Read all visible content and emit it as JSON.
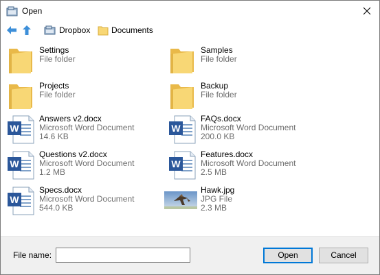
{
  "window": {
    "title": "Open"
  },
  "breadcrumb": {
    "items": [
      "Dropbox",
      "Documents"
    ]
  },
  "items": [
    {
      "name": "Settings",
      "type": "File folder",
      "size": "",
      "icon": "folder-icon"
    },
    {
      "name": "Samples",
      "type": "File folder",
      "size": "",
      "icon": "folder-icon"
    },
    {
      "name": "Projects",
      "type": "File folder",
      "size": "",
      "icon": "folder-icon"
    },
    {
      "name": "Backup",
      "type": "File folder",
      "size": "",
      "icon": "folder-icon"
    },
    {
      "name": "Answers v2.docx",
      "type": "Microsoft Word Document",
      "size": "14.6 KB",
      "icon": "word-document-icon"
    },
    {
      "name": "FAQs.docx",
      "type": "Microsoft Word Document",
      "size": "200.0 KB",
      "icon": "word-document-icon"
    },
    {
      "name": "Questions v2.docx",
      "type": "Microsoft Word Document",
      "size": "1.2 MB",
      "icon": "word-document-icon"
    },
    {
      "name": "Features.docx",
      "type": "Microsoft Word Document",
      "size": "2.5 MB",
      "icon": "word-document-icon"
    },
    {
      "name": "Specs.docx",
      "type": "Microsoft Word Document",
      "size": "544.0 KB",
      "icon": "word-document-icon"
    },
    {
      "name": "Hawk.jpg",
      "type": "JPG File",
      "size": "2.3 MB",
      "icon": "image-thumbnail-icon"
    }
  ],
  "footer": {
    "file_name_label": "File name:",
    "file_name_value": "",
    "open_label": "Open",
    "cancel_label": "Cancel"
  },
  "colors": {
    "accent": "#0078d7",
    "folder": "#f8d775",
    "word_blue": "#2b579a",
    "secondary_text": "#6d6d6d"
  }
}
